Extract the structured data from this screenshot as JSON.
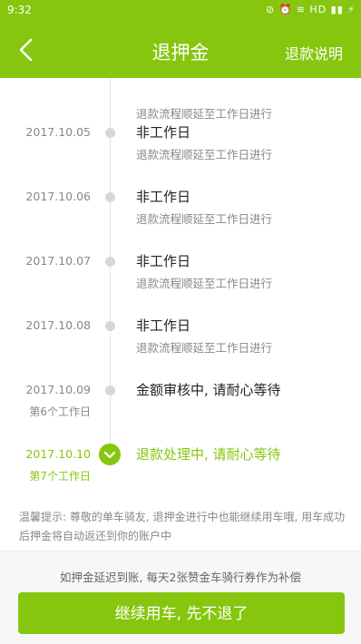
{
  "status_bar": {
    "time": "9:32",
    "indicators": "⊘ ⏰ ≋ HD ▮▮ ⚡"
  },
  "nav": {
    "title": "退押金",
    "help_label": "退款说明",
    "back_icon": "chevron-left-icon"
  },
  "timeline": [
    {
      "date": "",
      "status": "",
      "desc": "退款流程顺延至工作日进行",
      "workday": "",
      "active": false
    },
    {
      "date": "2017.10.05",
      "status": "非工作日",
      "desc": "退款流程顺延至工作日进行",
      "workday": "",
      "active": false
    },
    {
      "date": "2017.10.06",
      "status": "非工作日",
      "desc": "退款流程顺延至工作日进行",
      "workday": "",
      "active": false
    },
    {
      "date": "2017.10.07",
      "status": "非工作日",
      "desc": "退款流程顺延至工作日进行",
      "workday": "",
      "active": false
    },
    {
      "date": "2017.10.08",
      "status": "非工作日",
      "desc": "退款流程顺延至工作日进行",
      "workday": "",
      "active": false
    },
    {
      "date": "2017.10.09",
      "status": "金额审核中, 请耐心等待",
      "desc": "",
      "workday": "第6个工作日",
      "active": false
    },
    {
      "date": "2017.10.10",
      "status": "退款处理中, 请耐心等待",
      "desc": "",
      "workday": "第7个工作日",
      "active": true
    }
  ],
  "tip": "温馨提示: 尊敬的单车骑友, 退押金进行中也能继续用车哦, 用车成功后押金将自动返还到你的账户中",
  "bottom": {
    "notice": "如押金延迟到账, 每天2张赞金车骑行券作为补偿",
    "continue_label": "继续用车, 先不退了"
  },
  "colors": {
    "accent": "#86c60e",
    "muted": "#888888"
  }
}
